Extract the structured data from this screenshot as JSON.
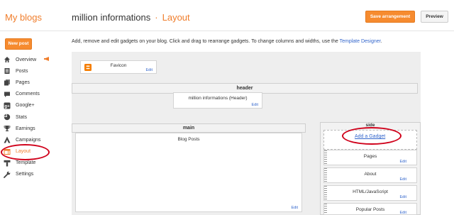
{
  "header": {
    "brand": "My blogs",
    "blog_name": "million informations",
    "separator": "·",
    "page_name": "Layout",
    "save_label": "Save arrangement",
    "preview_label": "Preview"
  },
  "sidebar": {
    "new_post_label": "New post",
    "items": [
      {
        "label": "Overview",
        "icon": "home-icon"
      },
      {
        "label": "Posts",
        "icon": "posts-icon"
      },
      {
        "label": "Pages",
        "icon": "pages-icon"
      },
      {
        "label": "Comments",
        "icon": "comments-icon"
      },
      {
        "label": "Google+",
        "icon": "google-plus-icon"
      },
      {
        "label": "Stats",
        "icon": "stats-icon"
      },
      {
        "label": "Earnings",
        "icon": "trophy-icon"
      },
      {
        "label": "Campaigns",
        "icon": "campaigns-icon"
      },
      {
        "label": "Layout",
        "icon": "layout-icon",
        "active": true
      },
      {
        "label": "Template",
        "icon": "template-icon"
      },
      {
        "label": "Settings",
        "icon": "wrench-icon"
      }
    ]
  },
  "main": {
    "instructions_text": "Add, remove and edit gadgets on your blog. Click and drag to rearrange gadgets. To change columns and widths, use the ",
    "instructions_link": "Template Designer",
    "instructions_end": ".",
    "favicon_label": "Favicon",
    "edit_label": "Edit",
    "header_section": "header",
    "header_gadget": "million informations (Header)",
    "main_section": "main",
    "blog_posts": "Blog Posts",
    "side_section": "side",
    "add_gadget": "Add a Gadget",
    "gadgets": [
      "Pages",
      "About",
      "HTML/JavaScript",
      "Popular Posts"
    ]
  },
  "colors": {
    "accent": "#f07d2b",
    "button": "#f68b2f",
    "link": "#3366cc",
    "highlight_circle": "#d0021b"
  }
}
